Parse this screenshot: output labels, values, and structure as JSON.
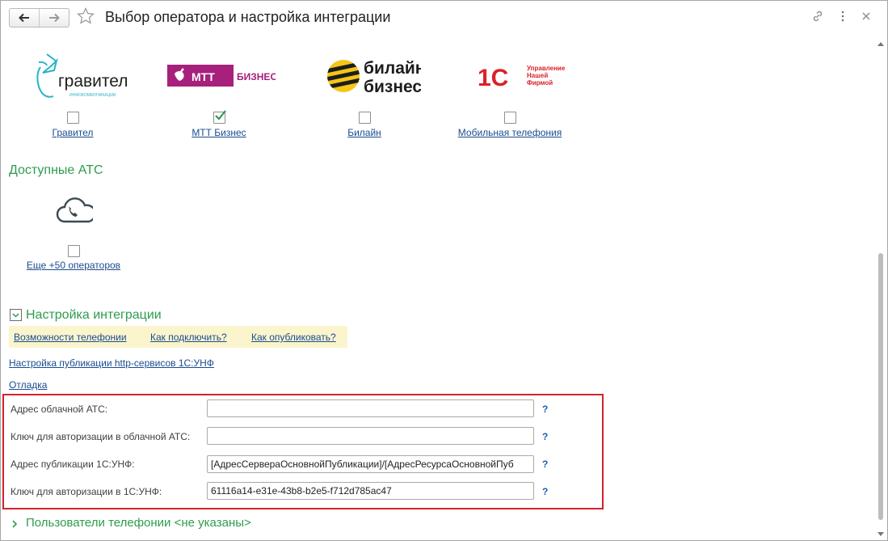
{
  "window": {
    "title": "Выбор оператора и настройка интеграции"
  },
  "operators": [
    {
      "label": "Гравител",
      "checked": false,
      "logo": {
        "brand": "гравител",
        "tagline": "ИНФОКОММУНИКАЦИИ"
      }
    },
    {
      "label": "МТТ Бизнес",
      "checked": true,
      "logo": {
        "brand": "МТТ",
        "suffix": "БИЗНЕС"
      }
    },
    {
      "label": "Билайн",
      "checked": false,
      "logo": {
        "line1": "билайн",
        "line2": "бизнес"
      }
    },
    {
      "label": "Мобильная телефония",
      "checked": false,
      "logo": {
        "mark": "1С",
        "line1": "Управление",
        "line2": "Нашей",
        "line3": "Фирмой"
      }
    }
  ],
  "ats": {
    "section_title": "Доступные АТС",
    "more_label": "Еще +50 операторов",
    "more_icon": "cloud-phone-icon",
    "checked": false
  },
  "integration": {
    "section_title": "Настройка интеграции",
    "expanded": true,
    "tabs": [
      "Возможности телефонии",
      "Как подключить?",
      "Как опубликовать?"
    ],
    "publish_link": "Настройка публикации http-сервисов 1С:УНФ",
    "debug_link": "Отладка",
    "fields": [
      {
        "label": "Адрес облачной АТС:",
        "value": "",
        "help": "?"
      },
      {
        "label": "Ключ для авторизации в облачной АТС:",
        "value": "",
        "help": "?"
      },
      {
        "label": "Адрес публикации 1С:УНФ:",
        "value": "[АдресСервераОсновнойПубликации]/[АдресРесурсаОсновнойПуб",
        "help": "?"
      },
      {
        "label": "Ключ для авторизации в 1С:УНФ:",
        "value": "61116a14-e31e-43b8-b2e5-f712d785ac47",
        "help": "?"
      }
    ]
  },
  "users": {
    "section_title": "Пользователи телефонии <не указаны>",
    "expanded": false
  },
  "colors": {
    "section_green": "#2e9c4e",
    "link_blue": "#1a4c8f",
    "highlight_red": "#d3222b",
    "tabs_bg": "#fbf5cd",
    "mtt_purple": "#a6207c",
    "beeline_yellow": "#f5c518",
    "onec_red": "#d9232b",
    "gravitel_teal": "#2bb3c7"
  },
  "icons": {
    "back": "arrow-left-icon",
    "forward": "arrow-right-icon",
    "favorite": "star-icon",
    "link": "link-icon",
    "more": "more-vertical-icon",
    "close": "close-icon"
  }
}
